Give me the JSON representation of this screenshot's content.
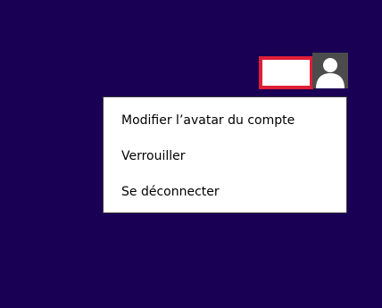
{
  "user": {
    "name": "",
    "avatar_icon": "user-silhouette-icon"
  },
  "account_menu": {
    "items": [
      {
        "label": "Modifier l’avatar du compte"
      },
      {
        "label": "Verrouiller"
      },
      {
        "label": "Se déconnecter"
      }
    ]
  },
  "colors": {
    "background": "#1a0055",
    "highlight_border": "#e01e36",
    "avatar_background": "#4c4c4c"
  }
}
